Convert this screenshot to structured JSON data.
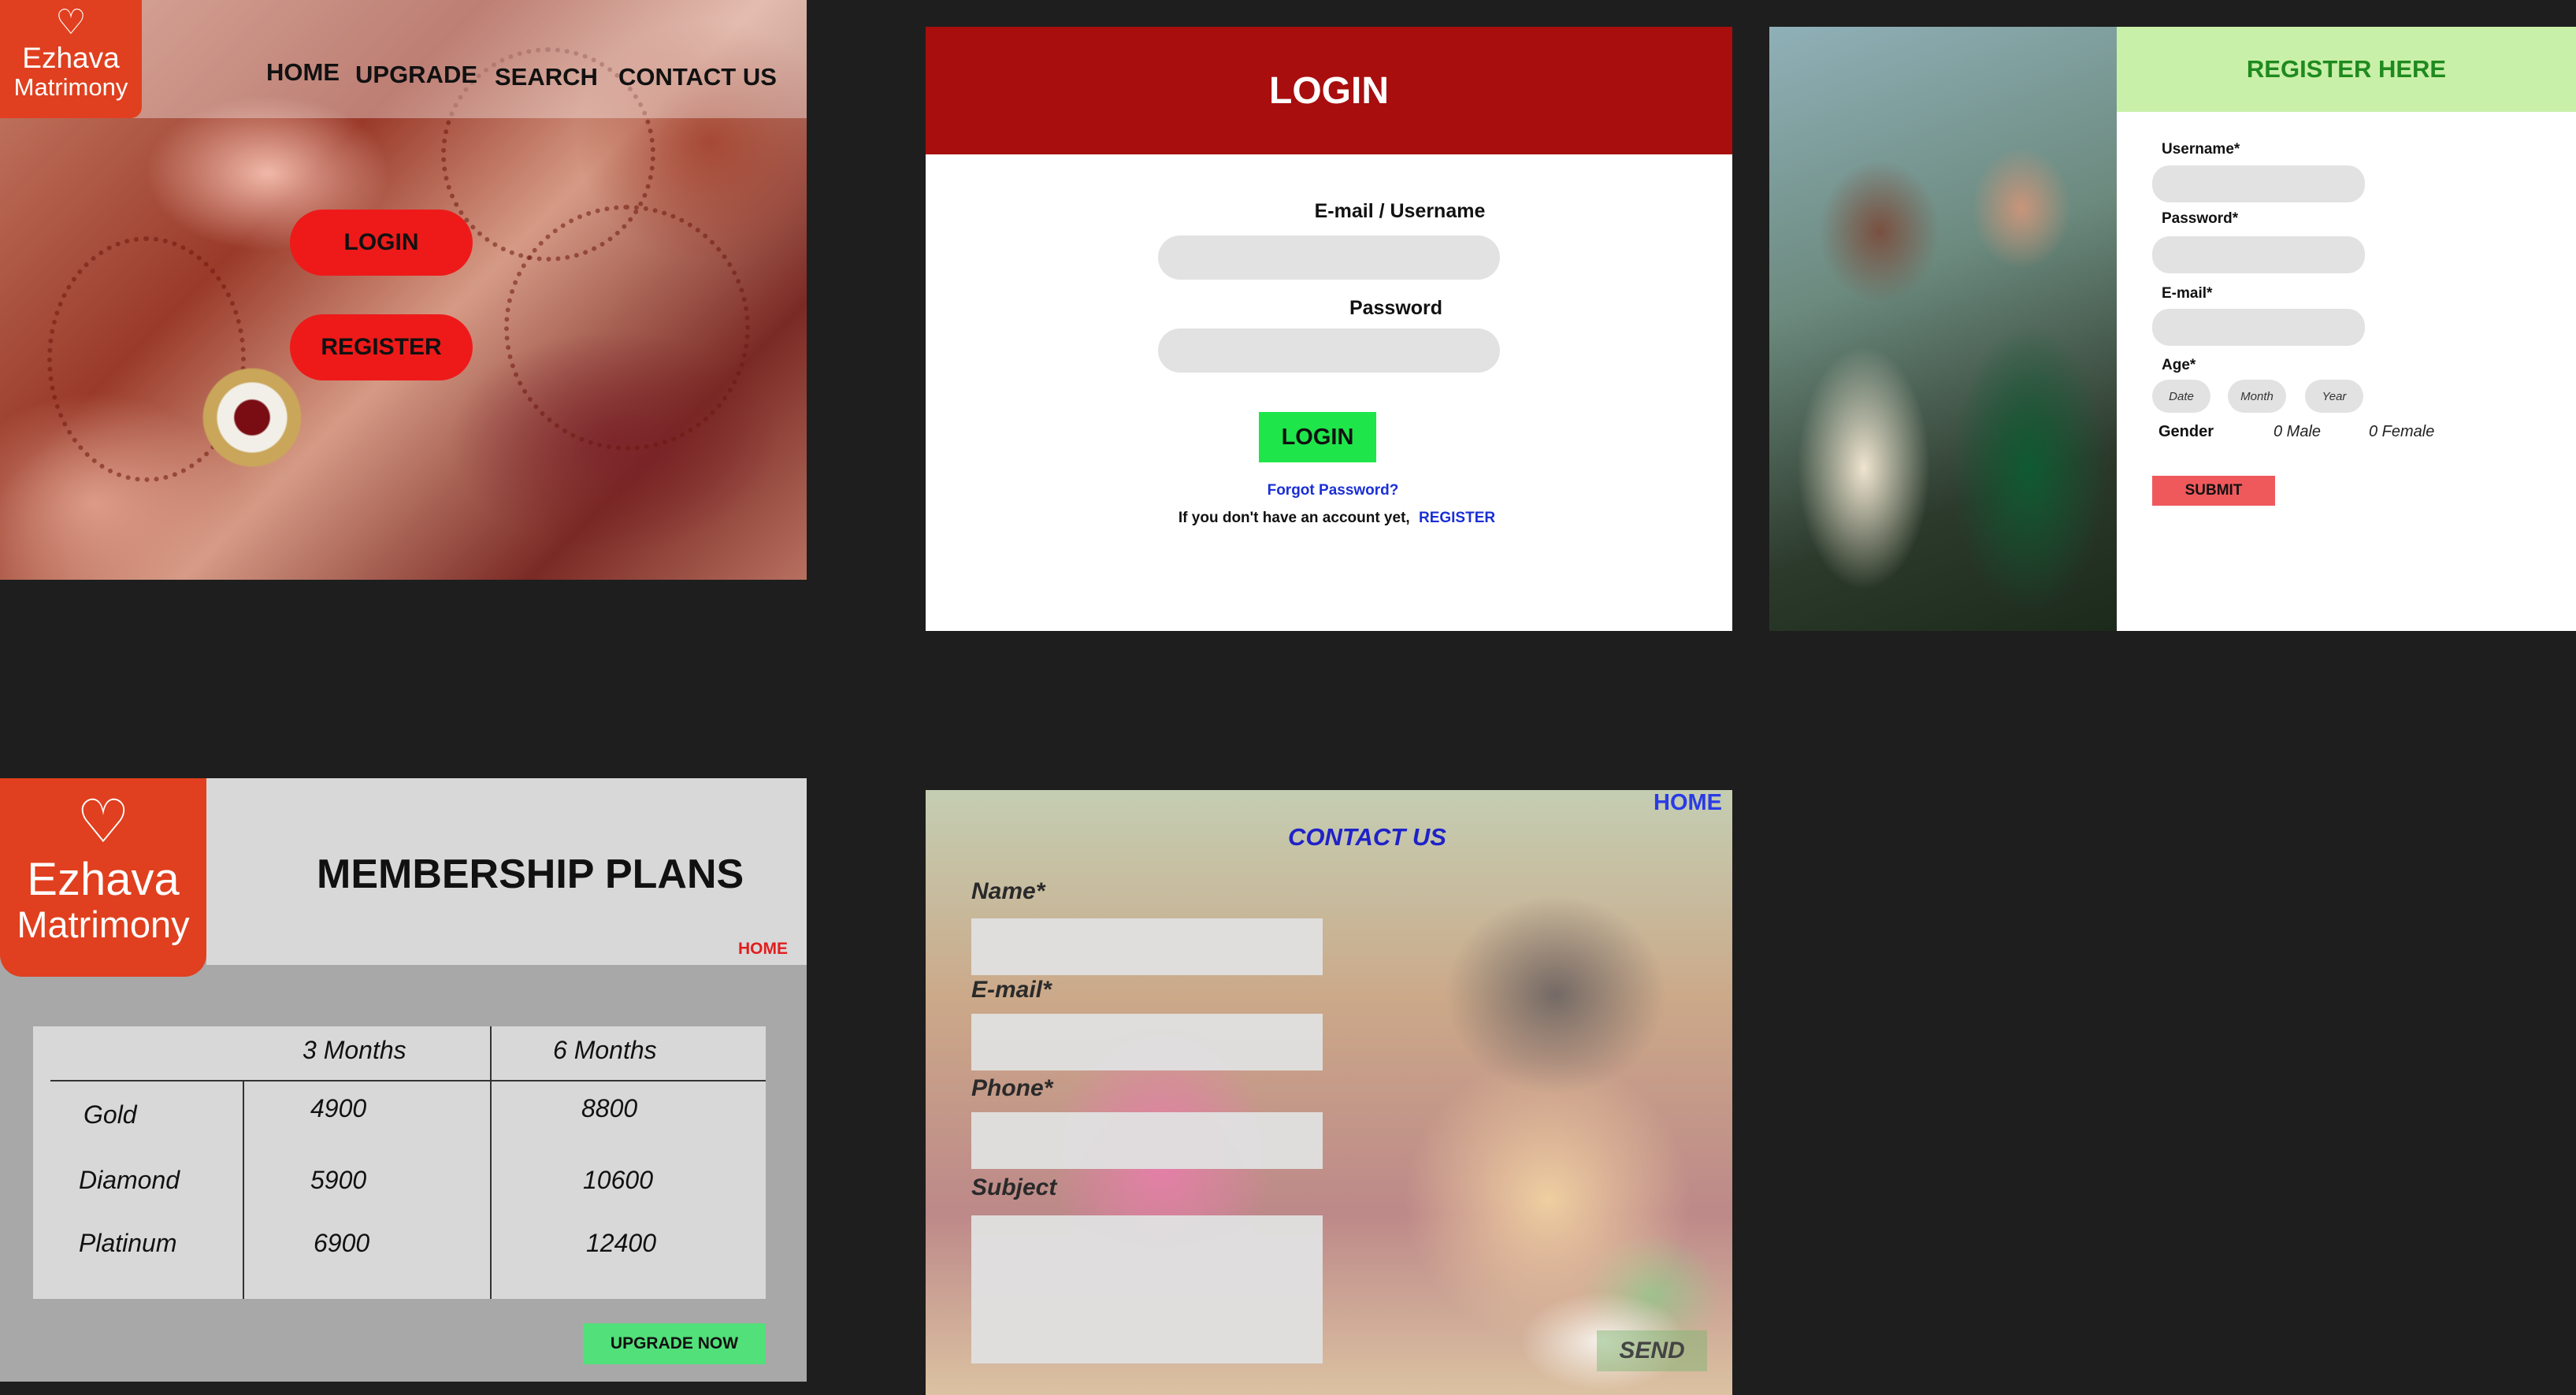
{
  "home": {
    "logo": {
      "line1": "Ezhava",
      "line2": "Matrimony"
    },
    "nav": [
      "HOME",
      "UPGRADE",
      "SEARCH",
      "CONTACT US"
    ],
    "login_label": "LOGIN",
    "register_label": "REGISTER"
  },
  "login": {
    "title": "LOGIN",
    "email_label": "E-mail / Username",
    "password_label": "Password",
    "button_label": "LOGIN",
    "forgot_label": "Forgot Password?",
    "no_account_text": "If you don't have an account yet,",
    "register_link": "REGISTER"
  },
  "register": {
    "title": "REGISTER HERE",
    "username_label": "Username*",
    "password_label": "Password*",
    "email_label": "E-mail*",
    "age_label": "Age*",
    "age_parts": [
      "Date",
      "Month",
      "Year"
    ],
    "gender_label": "Gender",
    "gender_options": [
      "0  Male",
      "0  Female"
    ],
    "submit_label": "SUBMIT"
  },
  "membership": {
    "logo": {
      "line1": "Ezhava",
      "line2": "Matrimony"
    },
    "title": "MEMBERSHIP PLANS",
    "home_link": "HOME",
    "columns": [
      "3 Months",
      "6 Months"
    ],
    "rows": [
      {
        "plan": "Gold",
        "m3": "4900",
        "m6": "8800"
      },
      {
        "plan": "Diamond",
        "m3": "5900",
        "m6": "10600"
      },
      {
        "plan": "Platinum",
        "m3": "6900",
        "m6": "12400"
      }
    ],
    "upgrade_label": "UPGRADE NOW"
  },
  "contact": {
    "home_link": "HOME",
    "title": "CONTACT US",
    "name_label": "Name*",
    "email_label": "E-mail*",
    "phone_label": "Phone*",
    "subject_label": "Subject",
    "send_label": "SEND"
  },
  "colors": {
    "logo": "#e0401f",
    "login_header": "#a80e0e",
    "login_button": "#1ee64a",
    "register_header_bg": "#c9f0a8",
    "register_header_text": "#1f8a1f",
    "submit": "#f0595c",
    "upgrade": "#52e07a",
    "link_blue": "#1a2fd6",
    "home_red": "#e01e1e"
  }
}
